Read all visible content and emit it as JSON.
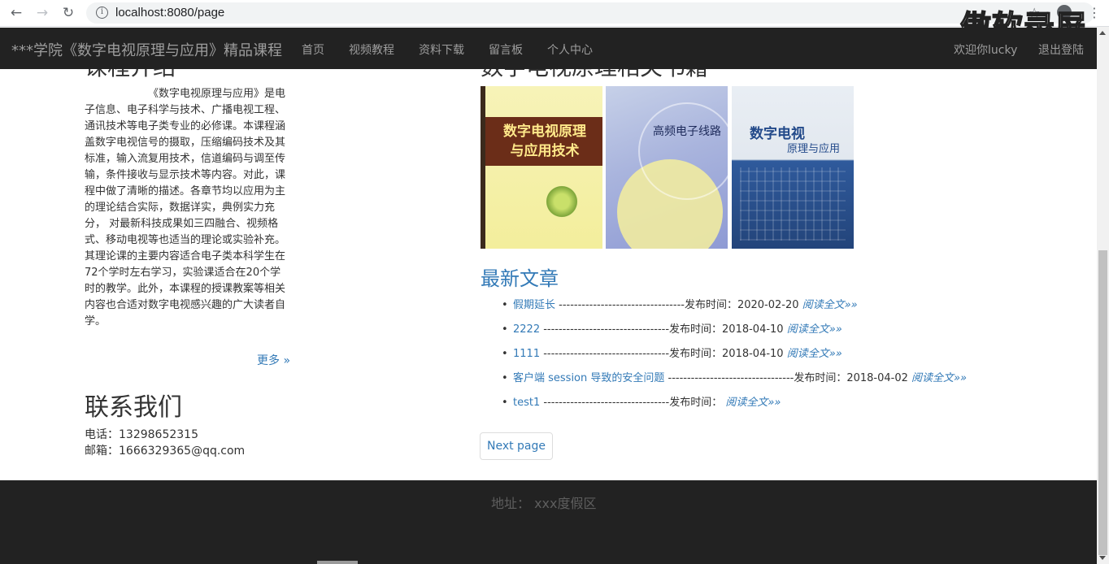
{
  "browser": {
    "url": "localhost:8080/page",
    "back_icon": "arrow-left-icon",
    "forward_icon": "arrow-right-icon",
    "reload_icon": "reload-icon",
    "info_icon": "info-icon",
    "star_icon": "star-icon",
    "account_icon": "account-icon",
    "menu_icon": "more-vertical-icon"
  },
  "watermark": "傲软录屏",
  "navbar": {
    "brand": "***学院《数字电视原理与应用》精品课程",
    "links": [
      "首页",
      "视频教程",
      "资料下载",
      "留言板",
      "个人中心"
    ],
    "welcome": "欢迎你lucky",
    "logout": "退出登陆"
  },
  "intro": {
    "heading_partial": "课程介绍",
    "text": "《数字电视原理与应用》是电子信息、电子科学与技术、广播电视工程、通讯技术等电子类专业的必修课。本课程涵盖数字电视信号的摄取，压缩编码技术及其标准，输入流复用技术，信道编码与调至传输，条件接收与显示技术等内容。对此，课程中做了清晰的描述。各章节均以应用为主的理论结合实际，数据详实，典例实力充分， 对最新科技成果如三四融合、视频格式、移动电视等也适当的理论或实验补充。其理论课的主要内容适合电子类本科学生在72个学时左右学习，实验课适合在20个学时的教学。此外，本课程的授课教案等相关内容也合适对数字电视感兴趣的广大读者自学。",
    "more": "更多 »"
  },
  "contact": {
    "title": "联系我们",
    "phone": "电话：13298652315",
    "email": "邮箱：1666329365@qq.com"
  },
  "books": {
    "heading_partial": "数字电视原理相关书籍",
    "items": [
      {
        "title_line1": "数字电视原理",
        "title_line2": "与应用技术"
      },
      {
        "title": "高频电子线路"
      },
      {
        "title": "数字电视",
        "subtitle": "原理与应用"
      }
    ]
  },
  "articles": {
    "title": "最新文章",
    "items": [
      {
        "name": "假期延长",
        "sep": " ---------------------------------",
        "date_label": "发布时间：2020-02-20 ",
        "more": "阅读全文»»"
      },
      {
        "name": "2222",
        "sep": " ---------------------------------",
        "date_label": "发布时间：2018-04-10 ",
        "more": "阅读全文»»"
      },
      {
        "name": "1111",
        "sep": " ---------------------------------",
        "date_label": "发布时间：2018-04-10 ",
        "more": "阅读全文»»"
      },
      {
        "name": "客户端 session 导致的安全问题",
        "sep": " ---------------------------------",
        "date_label": "发布时间：2018-04-02 ",
        "more": "阅读全文»»"
      },
      {
        "name": "test1",
        "sep": " ---------------------------------",
        "date_label": "发布时间： ",
        "more": "阅读全文»»"
      }
    ],
    "next_page": "Next page"
  },
  "footer": {
    "address": "地址： xxx度假区"
  }
}
